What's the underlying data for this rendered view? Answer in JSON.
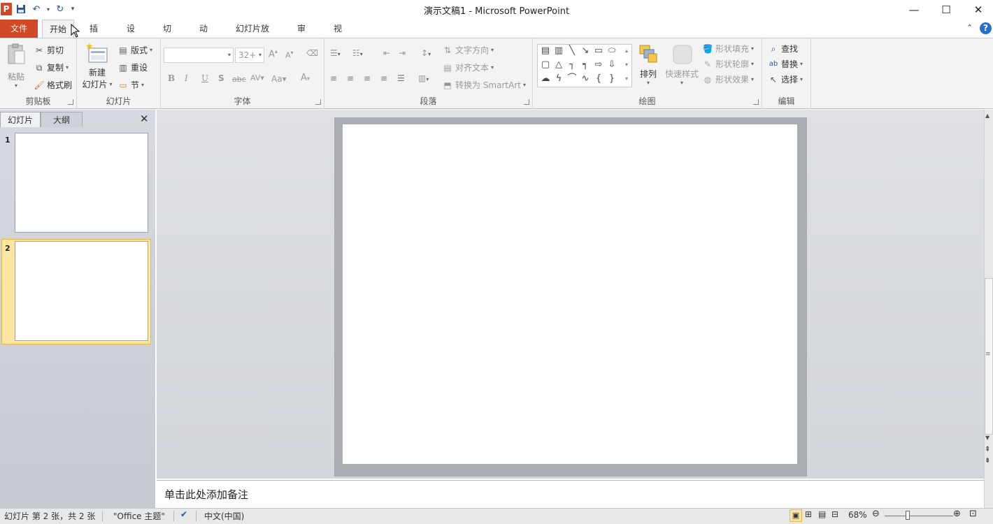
{
  "window": {
    "title": "演示文稿1 - Microsoft PowerPoint"
  },
  "ribbon_tabs": [
    "文件",
    "开始",
    "插入",
    "设计",
    "切换",
    "动画",
    "幻灯片放映",
    "审阅",
    "视图"
  ],
  "clipboard": {
    "paste": "粘贴",
    "cut": "剪切",
    "copy": "复制",
    "format_painter": "格式刷",
    "group_label": "剪贴板"
  },
  "slides_group": {
    "new_slide_line1": "新建",
    "new_slide_line2": "幻灯片",
    "layout": "版式",
    "reset": "重设",
    "section": "节",
    "group_label": "幻灯片"
  },
  "font_group": {
    "font_name": "",
    "font_size": "32+",
    "group_label": "字体"
  },
  "paragraph_group": {
    "text_direction": "文字方向",
    "align_text": "对齐文本",
    "convert_smartart": "转换为 SmartArt",
    "group_label": "段落"
  },
  "drawing_group": {
    "arrange": "排列",
    "quick_styles": "快速样式",
    "shape_fill": "形状填充",
    "shape_outline": "形状轮廓",
    "shape_effects": "形状效果",
    "group_label": "绘图"
  },
  "editing_group": {
    "find": "查找",
    "replace": "替换",
    "select": "选择",
    "group_label": "编辑"
  },
  "left_pane": {
    "tabs": [
      "幻灯片",
      "大纲"
    ],
    "slide_numbers": [
      "1",
      "2"
    ]
  },
  "notes": {
    "placeholder": "单击此处添加备注"
  },
  "status": {
    "slide_info": "幻灯片 第 2 张，共 2 张",
    "theme": "\"Office 主题\"",
    "language": "中文(中国)",
    "zoom": "68%",
    "zoom_level_fraction": 0.68
  },
  "colors": {
    "file_tab": "#d24726",
    "ribbon_bg": "#f3f3f3",
    "selected_slide": "#fde6a2"
  }
}
